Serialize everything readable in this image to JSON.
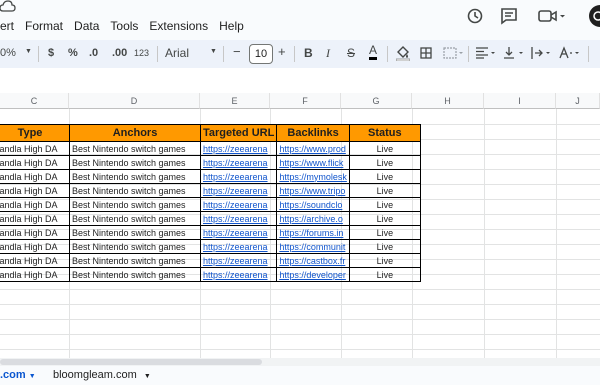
{
  "menu": [
    "ert",
    "Format",
    "Data",
    "Tools",
    "Extensions",
    "Help"
  ],
  "toolbar": {
    "zoom": "0%",
    "currency": "$",
    "percent": "%",
    "decrease_decimal": ".0",
    "increase_decimal": ".00",
    "number_format": "123",
    "font": "Arial",
    "minus": "−",
    "font_size": "10",
    "plus": "+",
    "bold": "B",
    "italic": "I",
    "strike": "S",
    "text_color": "A",
    "text_color_hex": "#000000"
  },
  "columns": [
    "C",
    "D",
    "E",
    "F",
    "G",
    "H",
    "I",
    "J"
  ],
  "table": {
    "headers": [
      "Type",
      "Anchors",
      "Targeted URL",
      "Backlinks",
      "Status"
    ],
    "header_color": "#ff9900",
    "rows": [
      [
        "Handla High DA",
        "Best Nintendo switch games",
        "https://zeearena",
        "https://www.prod",
        "Live"
      ],
      [
        "Handla High DA",
        "Best Nintendo switch games",
        "https://zeearena",
        "https://www.flick",
        "Live"
      ],
      [
        "Handla High DA",
        "Best Nintendo switch games",
        "https://zeearena",
        "https://mymolesk",
        "Live"
      ],
      [
        "Handla High DA",
        "Best Nintendo switch games",
        "https://zeearena",
        "https://www.tripo",
        "Live"
      ],
      [
        "Handla High DA",
        "Best Nintendo switch games",
        "https://zeearena",
        "https://soundclo",
        "Live"
      ],
      [
        "Handla High DA",
        "Best Nintendo switch games",
        "https://zeearena",
        "https://archive.o",
        "Live"
      ],
      [
        "Handla High DA",
        "Best Nintendo switch games",
        "https://zeearena",
        "https://forums.in",
        "Live"
      ],
      [
        "Handla High DA",
        "Best Nintendo switch games",
        "https://zeearena",
        "https://communit",
        "Live"
      ],
      [
        "Handla High DA",
        "Best Nintendo switch games",
        "https://zeearena",
        "https://castbox.fr",
        "Live"
      ],
      [
        "Handla High DA",
        "Best Nintendo switch games",
        "https://zeearena",
        "https://developer",
        "Live"
      ]
    ]
  },
  "sheets": [
    {
      "label": ".com",
      "active": true
    },
    {
      "label": "bloomgleam.com",
      "active": false
    }
  ],
  "colors": {
    "accent": "#0b57d0",
    "link": "#1155cc"
  }
}
